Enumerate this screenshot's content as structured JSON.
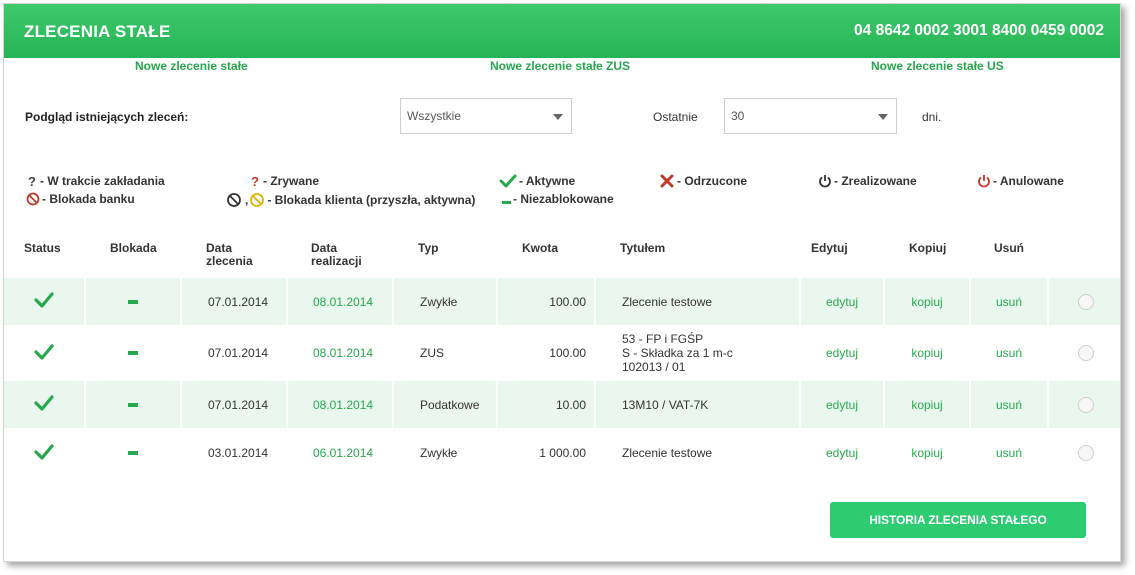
{
  "header": {
    "title": "ZLECENIA STAŁE",
    "account_number": "04 8642 0002 3001 8400 0459 0002"
  },
  "new_links": {
    "standing": "Nowe zlecenie stałe",
    "zus": "Nowe zlecenie stałe ZUS",
    "us": "Nowe zlecenie stałe US"
  },
  "filter": {
    "label": "Podgląd istniejących zleceń:",
    "type_value": "Wszystkie",
    "last_label": "Ostatnie",
    "days_value": "30",
    "days_unit": "dni."
  },
  "legend": {
    "in_progress": "- W trakcie zakładania",
    "bank_block": "- Blokada banku",
    "breaking": "- Zrywane",
    "client_block": "- Blokada klienta (przyszła, aktywna)",
    "client_block_sep": ",",
    "active": "- Aktywne",
    "unblocked": "- Niezablokowane",
    "rejected": "- Odrzucone",
    "realized": "- Zrealizowane",
    "cancelled": "- Anulowane"
  },
  "table": {
    "headers": {
      "status": "Status",
      "block": "Blokada",
      "order_date_1": "Data",
      "order_date_2": "zlecenia",
      "exec_date_1": "Data",
      "exec_date_2": "realizacji",
      "type": "Typ",
      "amount": "Kwota",
      "title": "Tytułem",
      "edit": "Edytuj",
      "copy": "Kopiuj",
      "delete": "Usuń"
    },
    "rows": [
      {
        "order_date": "07.01.2014",
        "exec_date": "08.01.2014",
        "type": "Zwykłe",
        "amount": "100.00",
        "title_lines": [
          "Zlecenie testowe"
        ],
        "edit": "edytuj",
        "copy": "kopiuj",
        "delete": "usuń"
      },
      {
        "order_date": "07.01.2014",
        "exec_date": "08.01.2014",
        "type": "ZUS",
        "amount": "100.00",
        "title_lines": [
          "53 - FP i FGŚP",
          "S - Składka za 1 m-c",
          "102013 / 01"
        ],
        "edit": "edytuj",
        "copy": "kopiuj",
        "delete": "usuń"
      },
      {
        "order_date": "07.01.2014",
        "exec_date": "08.01.2014",
        "type": "Podatkowe",
        "amount": "10.00",
        "title_lines": [
          "13M10 / VAT-7K"
        ],
        "edit": "edytuj",
        "copy": "kopiuj",
        "delete": "usuń"
      },
      {
        "order_date": "03.01.2014",
        "exec_date": "06.01.2014",
        "type": "Zwykłe",
        "amount": "1 000.00",
        "title_lines": [
          "Zlecenie testowe"
        ],
        "edit": "edytuj",
        "copy": "kopiuj",
        "delete": "usuń"
      }
    ]
  },
  "history_button": "HISTORIA ZLECENIA STAŁEGO",
  "icons": {
    "status": "checkmark-icon",
    "block": "dash-icon",
    "select": "radio-icon"
  },
  "colors": {
    "brand_green": "#27a84f",
    "header_green": "#2fbf5f",
    "button_green": "#2ecc71",
    "row_alt": "#e9f7ee",
    "rejected_red": "#c0392b",
    "cancelled_red": "#c0392b",
    "bank_block_red": "#c0392b",
    "client_block_yellow": "#e0b400"
  }
}
